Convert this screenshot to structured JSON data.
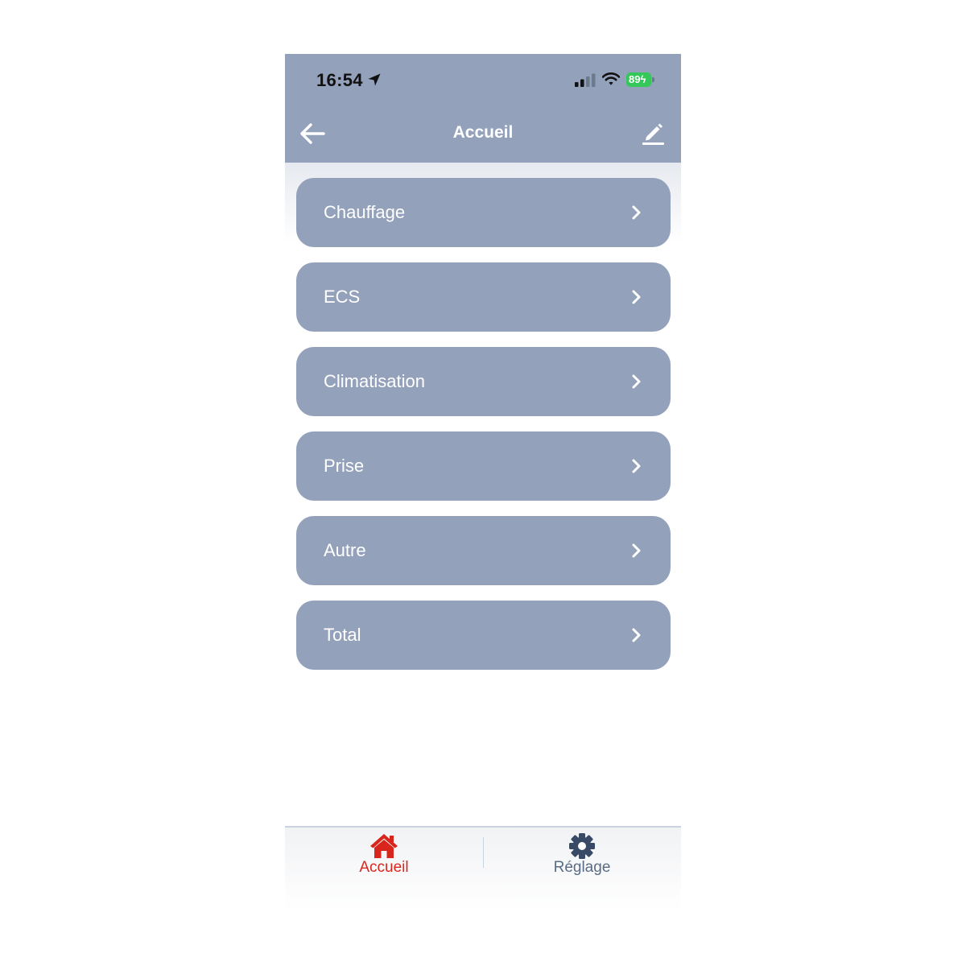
{
  "status_bar": {
    "time": "16:54",
    "battery_level": "89",
    "battery_color": "#34c759"
  },
  "nav": {
    "title": "Accueil",
    "back_icon": "arrow-left-icon",
    "edit_icon": "pencil-icon"
  },
  "menu": {
    "items": [
      {
        "label": "Chauffage"
      },
      {
        "label": "ECS"
      },
      {
        "label": "Climatisation"
      },
      {
        "label": "Prise"
      },
      {
        "label": "Autre"
      },
      {
        "label": "Total"
      }
    ]
  },
  "tabs": [
    {
      "label": "Accueil",
      "icon": "home-icon",
      "active": true,
      "color": "#d9261c"
    },
    {
      "label": "Réglage",
      "icon": "gear-icon",
      "active": false,
      "color": "#5a6c85"
    }
  ],
  "colors": {
    "header_bg": "#94a1bb",
    "menu_item_bg": "#94a1bb",
    "active_tab": "#d9261c",
    "inactive_tab": "#5a6c85"
  }
}
